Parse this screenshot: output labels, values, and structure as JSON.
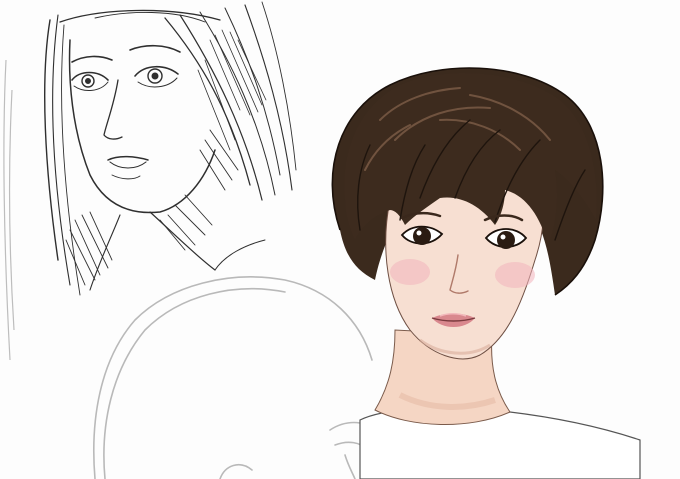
{
  "artwork": {
    "figures": [
      {
        "id": "pencil-sketch-woman",
        "style": "graphite line sketch",
        "color": "#2f2f2f"
      },
      {
        "id": "colored-bob-portrait",
        "style": "digital painting",
        "hair_color": "#3b2a1d",
        "skin_color": "#f6dcce",
        "lip_color": "#d98c8f",
        "cheek_color": "#f3b9bf"
      },
      {
        "id": "faint-head-construction",
        "style": "light gray construction lines",
        "color": "#b9b9b9"
      }
    ],
    "background_color": "#fdfdfd"
  }
}
